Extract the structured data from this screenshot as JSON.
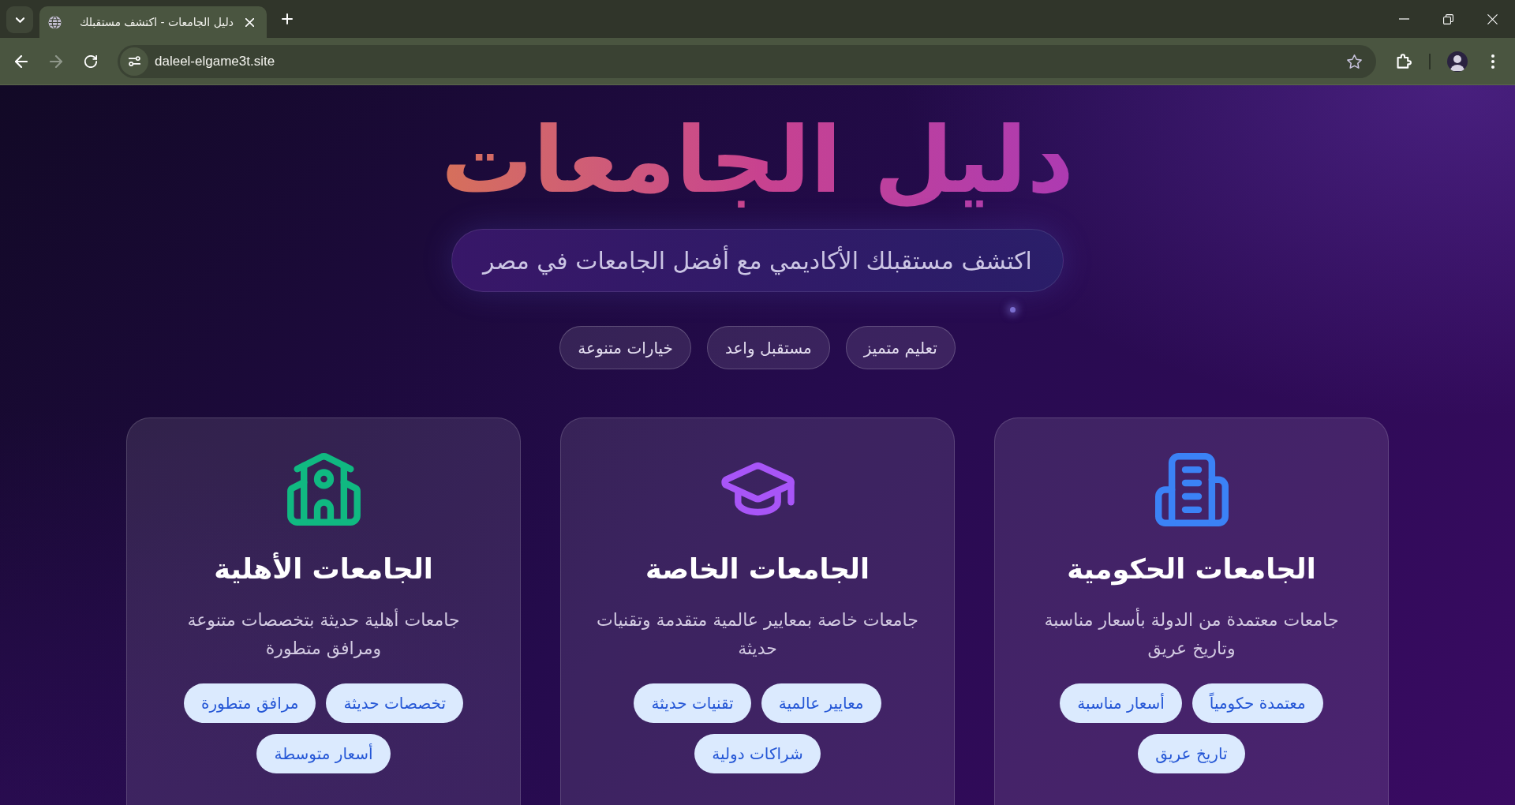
{
  "browser": {
    "tabs": [
      {
        "title": "دليل الجامعات - اكتشف مستقبلك",
        "selected": true
      }
    ],
    "navigation": [
      {
        "kind": "back",
        "disabled": false
      },
      {
        "kind": "forward",
        "disabled": true
      },
      {
        "kind": "reload",
        "disabled": false
      }
    ],
    "url": "daleel-elgame3t.site"
  },
  "hero": {
    "title": "دليل الجامعات",
    "subtitle": "اكتشف مستقبلك الأكاديمي مع أفضل الجامعات في مصر",
    "badges": [
      "تعليم متميز",
      "مستقبل واعد",
      "خيارات متنوعة"
    ]
  },
  "cards": [
    {
      "title": "الجامعات الحكومية",
      "description": "جامعات معتمدة من الدولة بأسعار مناسبة وتاريخ عريق",
      "color": "#3b82f6",
      "tags": [
        "معتمدة حكومياً",
        "أسعار مناسبة",
        "تاريخ عريق"
      ]
    },
    {
      "title": "الجامعات الخاصة",
      "description": "جامعات خاصة بمعايير عالمية متقدمة وتقنيات حديثة",
      "color": "#a855f7",
      "tags": [
        "معايير عالمية",
        "تقنيات حديثة",
        "شراكات دولية"
      ]
    },
    {
      "title": "الجامعات الأهلية",
      "description": "جامعات أهلية حديثة بتخصصات متنوعة ومرافق متطورة",
      "color": "#10b981",
      "tags": [
        "تخصصات حديثة",
        "مرافق متطورة",
        "أسعار متوسطة"
      ]
    }
  ]
}
